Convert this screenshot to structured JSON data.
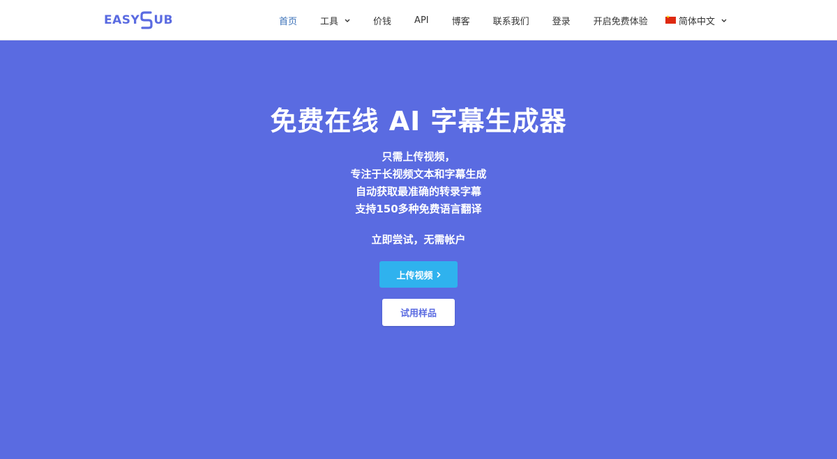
{
  "header": {
    "logo": {
      "left": "EASY",
      "right": "UB"
    },
    "nav": [
      {
        "label": "首页",
        "active": true
      },
      {
        "label": "工具",
        "dropdown": true
      },
      {
        "label": "价钱"
      },
      {
        "label": "API"
      },
      {
        "label": "博客"
      },
      {
        "label": "联系我们"
      },
      {
        "label": "登录"
      },
      {
        "label": "开启免费体验"
      }
    ],
    "language": {
      "label": "简体中文",
      "flag_icon": "china-flag-icon"
    }
  },
  "hero": {
    "title": "免费在线 AI 字幕生成器",
    "description": [
      "只需上传视频，",
      "专注于长视频文本和字幕生成",
      "自动获取最准确的转录字幕",
      "支持150多种免费语言翻译"
    ],
    "cta_text": "立即尝试，无需帐户",
    "upload_button": "上传视频",
    "sample_button": "试用样品"
  },
  "colors": {
    "brand": "#5a6be1",
    "upload_button": "#2fb2ee",
    "active_nav": "#3a70b8"
  }
}
